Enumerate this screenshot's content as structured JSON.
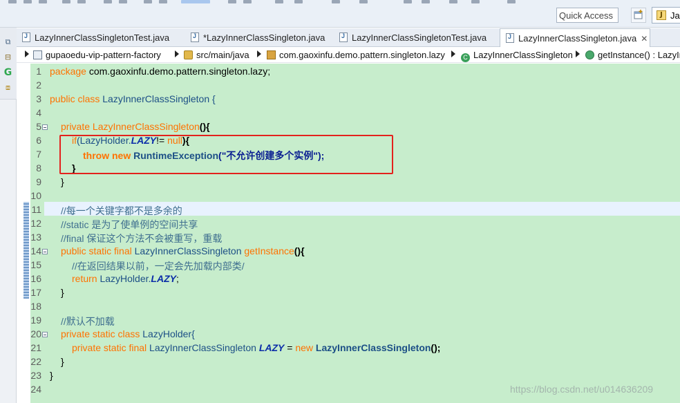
{
  "toolbar": {
    "quick_access_label": "Quick Access",
    "perspective_label": "Jav"
  },
  "tabs": [
    {
      "label": "LazyInnerClassSingletonTest.java",
      "active": false
    },
    {
      "label": "*LazyInnerClassSingleton.java",
      "active": false
    },
    {
      "label": "LazyInnerClassSingletonTest.java",
      "active": false
    },
    {
      "label": "LazyInnerClassSingleton.java",
      "active": true,
      "close": "✕"
    }
  ],
  "breadcrumb": [
    {
      "label": "gupaoedu-vip-pattern-factory",
      "icon": "project-icon"
    },
    {
      "label": "src/main/java",
      "icon": "source-folder-icon"
    },
    {
      "label": "com.gaoxinfu.demo.pattern.singleton.lazy",
      "icon": "package-icon"
    },
    {
      "label": "LazyInnerClassSingleton",
      "icon": "class-icon"
    },
    {
      "label": "getInstance() : LazyIn",
      "icon": "method-icon"
    }
  ],
  "editor": {
    "line_numbers": [
      "1",
      "2",
      "3",
      "4",
      "5",
      "6",
      "7",
      "8",
      "9",
      "10",
      "11",
      "12",
      "13",
      "14",
      "15",
      "16",
      "17",
      "18",
      "19",
      "20",
      "21",
      "22",
      "23",
      "24"
    ],
    "lines": {
      "l1_kw": "package",
      "l1_rest": " com.gaoxinfu.demo.pattern.singleton.lazy;",
      "l3_kw": "public class",
      "l3_rest": " LazyInnerClassSingleton {",
      "l5_kw": "private",
      "l5_name": "LazyInnerClassSingleton",
      "l5_rest": "(){",
      "l6_if": "if",
      "l6_a": "(LazyHolder.",
      "l6_field": "LAZY",
      "l6_b": "!= ",
      "l6_null": "null",
      "l6_c": "){",
      "l7_throw": "throw new",
      "l7_cls": "RuntimeException",
      "l7_str": "(\"不允许创建多个实例\");",
      "l8": "}",
      "l9": "}",
      "l11": "//每一个关键字都不是多余的",
      "l12": "//static 是为了使单例的空间共享",
      "l13": "//final 保证这个方法不会被重写，重载",
      "l14_kw": "public static final",
      "l14_type": " LazyInnerClassSingleton ",
      "l14_m": "getInstance",
      "l14_rest": "(){",
      "l15": "//在返回结果以前，一定会先加载内部类/",
      "l16_kw": "return",
      "l16_a": " LazyHolder.",
      "l16_field": "LAZY",
      "l16_b": ";",
      "l17": "}",
      "l19": "//默认不加载",
      "l20_kw": "private static class",
      "l20_rest": " LazyHolder{",
      "l21_kw": "private static final",
      "l21_type": " LazyInnerClassSingleton ",
      "l21_field": "LAZY",
      "l21_eq": " = ",
      "l21_new": "new",
      "l21_cls": " LazyInnerClassSingleton",
      "l21_rest": "();",
      "l22": "}",
      "l23": "}"
    }
  },
  "watermark": "https://blog.csdn.net/u014636209",
  "colors": {
    "editor_bg": "#c7edcc",
    "keyword": "#ff7200",
    "comment": "#3f6f8f",
    "highlight_box": "#e3211c"
  }
}
